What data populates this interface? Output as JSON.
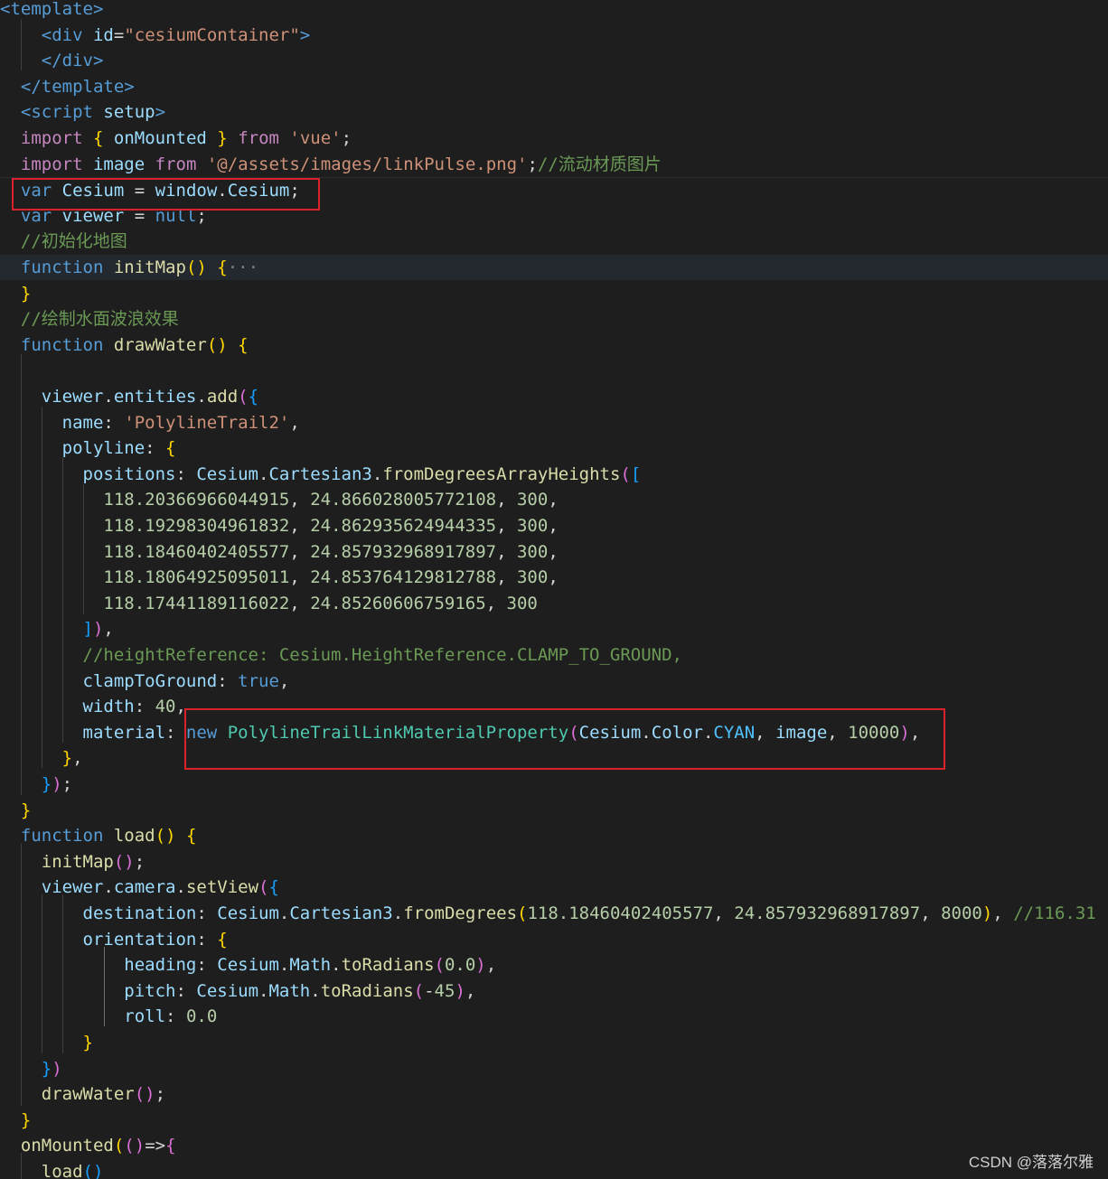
{
  "editor": {
    "lines": [
      {
        "tokens": [
          [
            "tag",
            "<template>"
          ]
        ]
      },
      {
        "tokens": [
          [
            "txt",
            "    "
          ],
          [
            "tag",
            "<div "
          ],
          [
            "attr",
            "id"
          ],
          [
            "txt",
            "="
          ],
          [
            "str",
            "\"cesiumContainer\""
          ],
          [
            "tag",
            ">"
          ]
        ]
      },
      {
        "tokens": [
          [
            "txt",
            "    "
          ],
          [
            "tag",
            "</div>"
          ]
        ]
      },
      {
        "tokens": [
          [
            "txt",
            "  "
          ],
          [
            "tag",
            "</template>"
          ]
        ]
      },
      {
        "tokens": [
          [
            "txt",
            "  "
          ],
          [
            "tag",
            "<script "
          ],
          [
            "attr",
            "setup"
          ],
          [
            "tag",
            ">"
          ]
        ]
      },
      {
        "tokens": [
          [
            "txt",
            "  "
          ],
          [
            "ctrl",
            "import"
          ],
          [
            "txt",
            " "
          ],
          [
            "br1",
            "{"
          ],
          [
            "txt",
            " "
          ],
          [
            "var",
            "onMounted"
          ],
          [
            "txt",
            " "
          ],
          [
            "br1",
            "}"
          ],
          [
            "txt",
            " "
          ],
          [
            "ctrl",
            "from"
          ],
          [
            "txt",
            " "
          ],
          [
            "str",
            "'vue'"
          ],
          [
            "txt",
            ";"
          ]
        ]
      },
      {
        "tokens": [
          [
            "txt",
            "  "
          ],
          [
            "ctrl",
            "import"
          ],
          [
            "txt",
            " "
          ],
          [
            "var",
            "image"
          ],
          [
            "txt",
            " "
          ],
          [
            "ctrl",
            "from"
          ],
          [
            "txt",
            " "
          ],
          [
            "str",
            "'@/assets/images/linkPulse.png'"
          ],
          [
            "txt",
            ";"
          ],
          [
            "cmt",
            "//流动材质图片"
          ]
        ]
      },
      {
        "tokens": [
          [
            "txt",
            "  "
          ],
          [
            "kw",
            "var"
          ],
          [
            "txt",
            " "
          ],
          [
            "var",
            "Cesium"
          ],
          [
            "txt",
            " = "
          ],
          [
            "var",
            "window"
          ],
          [
            "txt",
            "."
          ],
          [
            "var",
            "Cesium"
          ],
          [
            "txt",
            ";"
          ]
        ]
      },
      {
        "tokens": [
          [
            "txt",
            "  "
          ],
          [
            "kw",
            "var"
          ],
          [
            "txt",
            " "
          ],
          [
            "var",
            "viewer"
          ],
          [
            "txt",
            " = "
          ],
          [
            "kw",
            "null"
          ],
          [
            "txt",
            ";"
          ]
        ]
      },
      {
        "tokens": [
          [
            "txt",
            "  "
          ],
          [
            "cmt",
            "//初始化地图"
          ]
        ]
      },
      {
        "tokens": [
          [
            "txt",
            "  "
          ],
          [
            "kw",
            "function"
          ],
          [
            "txt",
            " "
          ],
          [
            "fn",
            "initMap"
          ],
          [
            "br1",
            "()"
          ],
          [
            "txt",
            " "
          ],
          [
            "br1",
            "{"
          ],
          [
            "pun",
            "···"
          ]
        ]
      },
      {
        "tokens": [
          [
            "txt",
            "  "
          ],
          [
            "br1",
            "}"
          ]
        ]
      },
      {
        "tokens": [
          [
            "txt",
            "  "
          ],
          [
            "cmt",
            "//绘制水面波浪效果"
          ]
        ]
      },
      {
        "tokens": [
          [
            "txt",
            "  "
          ],
          [
            "kw",
            "function"
          ],
          [
            "txt",
            " "
          ],
          [
            "fn",
            "drawWater"
          ],
          [
            "br1",
            "()"
          ],
          [
            "txt",
            " "
          ],
          [
            "br1",
            "{"
          ]
        ]
      },
      {
        "tokens": []
      },
      {
        "tokens": [
          [
            "txt",
            "    "
          ],
          [
            "var",
            "viewer"
          ],
          [
            "txt",
            "."
          ],
          [
            "var",
            "entities"
          ],
          [
            "txt",
            "."
          ],
          [
            "fn",
            "add"
          ],
          [
            "br2",
            "("
          ],
          [
            "br3",
            "{"
          ]
        ]
      },
      {
        "tokens": [
          [
            "txt",
            "      "
          ],
          [
            "var",
            "name"
          ],
          [
            "txt",
            ": "
          ],
          [
            "str",
            "'PolylineTrail2'"
          ],
          [
            "txt",
            ","
          ]
        ]
      },
      {
        "tokens": [
          [
            "txt",
            "      "
          ],
          [
            "var",
            "polyline"
          ],
          [
            "txt",
            ": "
          ],
          [
            "br1",
            "{"
          ]
        ]
      },
      {
        "tokens": [
          [
            "txt",
            "        "
          ],
          [
            "var",
            "positions"
          ],
          [
            "txt",
            ": "
          ],
          [
            "var",
            "Cesium"
          ],
          [
            "txt",
            "."
          ],
          [
            "var",
            "Cartesian3"
          ],
          [
            "txt",
            "."
          ],
          [
            "fn",
            "fromDegreesArrayHeights"
          ],
          [
            "br2",
            "("
          ],
          [
            "br3",
            "["
          ]
        ]
      },
      {
        "tokens": [
          [
            "txt",
            "          "
          ],
          [
            "num",
            "118.20366966044915"
          ],
          [
            "txt",
            ", "
          ],
          [
            "num",
            "24.866028005772108"
          ],
          [
            "txt",
            ", "
          ],
          [
            "num",
            "300"
          ],
          [
            "txt",
            ","
          ]
        ]
      },
      {
        "tokens": [
          [
            "txt",
            "          "
          ],
          [
            "num",
            "118.19298304961832"
          ],
          [
            "txt",
            ", "
          ],
          [
            "num",
            "24.862935624944335"
          ],
          [
            "txt",
            ", "
          ],
          [
            "num",
            "300"
          ],
          [
            "txt",
            ","
          ]
        ]
      },
      {
        "tokens": [
          [
            "txt",
            "          "
          ],
          [
            "num",
            "118.18460402405577"
          ],
          [
            "txt",
            ", "
          ],
          [
            "num",
            "24.857932968917897"
          ],
          [
            "txt",
            ", "
          ],
          [
            "num",
            "300"
          ],
          [
            "txt",
            ","
          ]
        ]
      },
      {
        "tokens": [
          [
            "txt",
            "          "
          ],
          [
            "num",
            "118.18064925095011"
          ],
          [
            "txt",
            ", "
          ],
          [
            "num",
            "24.853764129812788"
          ],
          [
            "txt",
            ", "
          ],
          [
            "num",
            "300"
          ],
          [
            "txt",
            ","
          ]
        ]
      },
      {
        "tokens": [
          [
            "txt",
            "          "
          ],
          [
            "num",
            "118.17441189116022"
          ],
          [
            "txt",
            ", "
          ],
          [
            "num",
            "24.85260606759165"
          ],
          [
            "txt",
            ", "
          ],
          [
            "num",
            "300"
          ]
        ]
      },
      {
        "tokens": [
          [
            "txt",
            "        "
          ],
          [
            "br3",
            "]"
          ],
          [
            "br2",
            ")"
          ],
          [
            "txt",
            ","
          ]
        ]
      },
      {
        "tokens": [
          [
            "txt",
            "        "
          ],
          [
            "cmt",
            "//heightReference: Cesium.HeightReference.CLAMP_TO_GROUND,"
          ]
        ]
      },
      {
        "tokens": [
          [
            "txt",
            "        "
          ],
          [
            "var",
            "clampToGround"
          ],
          [
            "txt",
            ": "
          ],
          [
            "kw",
            "true"
          ],
          [
            "txt",
            ","
          ]
        ]
      },
      {
        "tokens": [
          [
            "txt",
            "        "
          ],
          [
            "var",
            "width"
          ],
          [
            "txt",
            ": "
          ],
          [
            "num",
            "40"
          ],
          [
            "txt",
            ","
          ]
        ]
      },
      {
        "tokens": [
          [
            "txt",
            "        "
          ],
          [
            "var",
            "material"
          ],
          [
            "txt",
            ": "
          ],
          [
            "kw",
            "new"
          ],
          [
            "txt",
            " "
          ],
          [
            "cls",
            "PolylineTrailLinkMaterialProperty"
          ],
          [
            "br2",
            "("
          ],
          [
            "var",
            "Cesium"
          ],
          [
            "txt",
            "."
          ],
          [
            "var",
            "Color"
          ],
          [
            "txt",
            "."
          ],
          [
            "cst",
            "CYAN"
          ],
          [
            "txt",
            ", "
          ],
          [
            "var",
            "image"
          ],
          [
            "txt",
            ", "
          ],
          [
            "num",
            "10000"
          ],
          [
            "br2",
            ")"
          ],
          [
            "txt",
            ","
          ]
        ]
      },
      {
        "tokens": [
          [
            "txt",
            "      "
          ],
          [
            "br1",
            "}"
          ],
          [
            "txt",
            ","
          ]
        ]
      },
      {
        "tokens": [
          [
            "txt",
            "    "
          ],
          [
            "br3",
            "}"
          ],
          [
            "br2",
            ")"
          ],
          [
            "txt",
            ";"
          ]
        ]
      },
      {
        "tokens": [
          [
            "txt",
            "  "
          ],
          [
            "br1",
            "}"
          ]
        ]
      },
      {
        "tokens": [
          [
            "txt",
            "  "
          ],
          [
            "kw",
            "function"
          ],
          [
            "txt",
            " "
          ],
          [
            "fn",
            "load"
          ],
          [
            "br1",
            "()"
          ],
          [
            "txt",
            " "
          ],
          [
            "br1",
            "{"
          ]
        ]
      },
      {
        "tokens": [
          [
            "txt",
            "    "
          ],
          [
            "fn",
            "initMap"
          ],
          [
            "br2",
            "()"
          ],
          [
            "txt",
            ";"
          ]
        ]
      },
      {
        "tokens": [
          [
            "txt",
            "    "
          ],
          [
            "var",
            "viewer"
          ],
          [
            "txt",
            "."
          ],
          [
            "var",
            "camera"
          ],
          [
            "txt",
            "."
          ],
          [
            "fn",
            "setView"
          ],
          [
            "br2",
            "("
          ],
          [
            "br3",
            "{"
          ]
        ]
      },
      {
        "tokens": [
          [
            "txt",
            "        "
          ],
          [
            "var",
            "destination"
          ],
          [
            "txt",
            ": "
          ],
          [
            "var",
            "Cesium"
          ],
          [
            "txt",
            "."
          ],
          [
            "var",
            "Cartesian3"
          ],
          [
            "txt",
            "."
          ],
          [
            "fn",
            "fromDegrees"
          ],
          [
            "br1",
            "("
          ],
          [
            "num",
            "118.18460402405577"
          ],
          [
            "txt",
            ", "
          ],
          [
            "num",
            "24.857932968917897"
          ],
          [
            "txt",
            ", "
          ],
          [
            "num",
            "8000"
          ],
          [
            "br1",
            ")"
          ],
          [
            "txt",
            ", "
          ],
          [
            "cmt",
            "//116.31"
          ]
        ]
      },
      {
        "tokens": [
          [
            "txt",
            "        "
          ],
          [
            "var",
            "orientation"
          ],
          [
            "txt",
            ": "
          ],
          [
            "br1",
            "{"
          ]
        ]
      },
      {
        "tokens": [
          [
            "txt",
            "            "
          ],
          [
            "var",
            "heading"
          ],
          [
            "txt",
            ": "
          ],
          [
            "var",
            "Cesium"
          ],
          [
            "txt",
            "."
          ],
          [
            "var",
            "Math"
          ],
          [
            "txt",
            "."
          ],
          [
            "fn",
            "toRadians"
          ],
          [
            "br2",
            "("
          ],
          [
            "num",
            "0.0"
          ],
          [
            "br2",
            ")"
          ],
          [
            "txt",
            ","
          ]
        ]
      },
      {
        "tokens": [
          [
            "txt",
            "            "
          ],
          [
            "var",
            "pitch"
          ],
          [
            "txt",
            ": "
          ],
          [
            "var",
            "Cesium"
          ],
          [
            "txt",
            "."
          ],
          [
            "var",
            "Math"
          ],
          [
            "txt",
            "."
          ],
          [
            "fn",
            "toRadians"
          ],
          [
            "br2",
            "("
          ],
          [
            "txt",
            "-"
          ],
          [
            "num",
            "45"
          ],
          [
            "br2",
            ")"
          ],
          [
            "txt",
            ","
          ]
        ]
      },
      {
        "tokens": [
          [
            "txt",
            "            "
          ],
          [
            "var",
            "roll"
          ],
          [
            "txt",
            ": "
          ],
          [
            "num",
            "0.0"
          ]
        ]
      },
      {
        "tokens": [
          [
            "txt",
            "        "
          ],
          [
            "br1",
            "}"
          ]
        ]
      },
      {
        "tokens": [
          [
            "txt",
            "    "
          ],
          [
            "br3",
            "}"
          ],
          [
            "br2",
            ")"
          ]
        ]
      },
      {
        "tokens": [
          [
            "txt",
            "    "
          ],
          [
            "fn",
            "drawWater"
          ],
          [
            "br2",
            "()"
          ],
          [
            "txt",
            ";"
          ]
        ]
      },
      {
        "tokens": [
          [
            "txt",
            "  "
          ],
          [
            "br1",
            "}"
          ]
        ]
      },
      {
        "tokens": [
          [
            "txt",
            "  "
          ],
          [
            "fn",
            "onMounted"
          ],
          [
            "br1",
            "("
          ],
          [
            "br2",
            "()"
          ],
          [
            "txt",
            "=>"
          ],
          [
            "br2",
            "{"
          ]
        ]
      },
      {
        "tokens": [
          [
            "txt",
            "    "
          ],
          [
            "fn",
            "load"
          ],
          [
            "br3",
            "()"
          ]
        ]
      }
    ]
  },
  "watermark": "CSDN @落落尔雅",
  "colors": {
    "background": "#1e1e1e",
    "highlight_box": "#d9222a",
    "current_line": "#23292f"
  }
}
